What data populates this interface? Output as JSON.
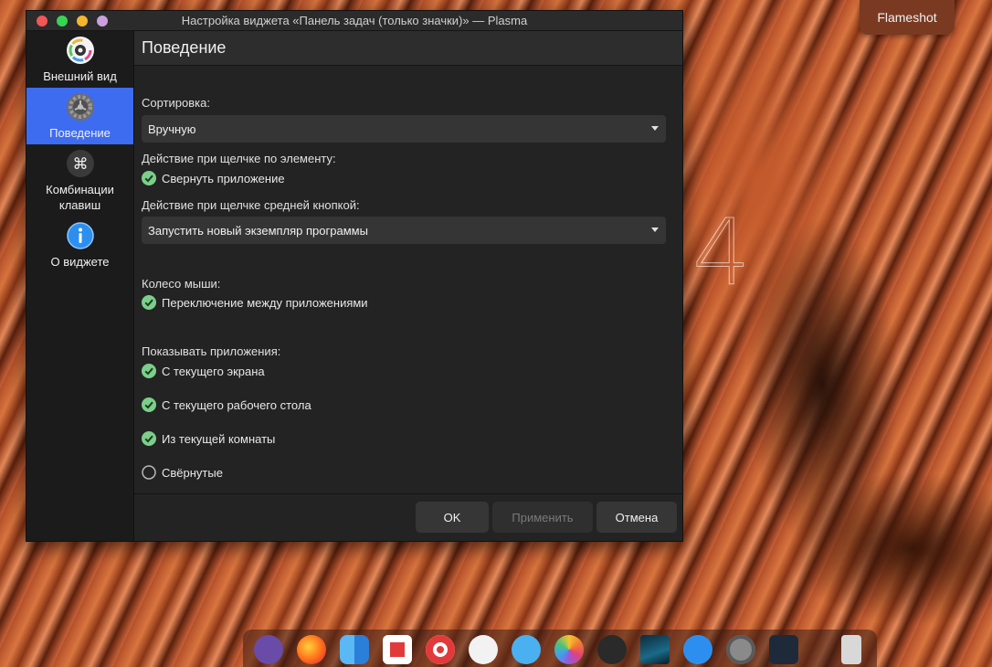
{
  "window": {
    "title": "Настройка виджета «Панель задач (только значки)» — Plasma"
  },
  "sidebar": {
    "items": [
      {
        "label": "Внешний вид",
        "icon": "appearance-icon"
      },
      {
        "label": "Поведение",
        "icon": "gear-icon",
        "active": true
      },
      {
        "label": "Комбинации\nклавиш",
        "icon": "command-key-icon"
      },
      {
        "label": "О виджете",
        "icon": "info-icon"
      }
    ]
  },
  "main": {
    "page_title": "Поведение",
    "sort": {
      "label": "Сортировка:",
      "value": "Вручную"
    },
    "click_action": {
      "label": "Действие при щелчке по элементу:",
      "option": "Свернуть приложение",
      "checked": true
    },
    "middle_click": {
      "label": "Действие при щелчке средней кнопкой:",
      "value": "Запустить новый экземпляр программы"
    },
    "wheel": {
      "label": "Колесо мыши:",
      "option": "Переключение между приложениями",
      "checked": true
    },
    "show_apps": {
      "label": "Показывать приложения:",
      "options": [
        {
          "label": "С текущего экрана",
          "checked": true
        },
        {
          "label": "С текущего рабочего стола",
          "checked": true
        },
        {
          "label": "Из текущей комнаты",
          "checked": true
        },
        {
          "label": "Свёрнутые",
          "checked": false
        }
      ]
    }
  },
  "footer": {
    "ok": "OK",
    "apply": "Применить",
    "cancel": "Отмена"
  },
  "desktop": {
    "desktop_number": "4",
    "flameshot": "Flameshot"
  },
  "dock": {
    "icons": [
      "mustache-app-icon",
      "firefox-icon",
      "finder-icon",
      "flipboard-icon",
      "record-icon",
      "proxyman-icon",
      "swift-icon",
      "photos-icon",
      "terminal-icon",
      "wallpaper-icon",
      "app-store-icon",
      "system-preferences-icon",
      "screen-sharing-icon",
      "trash-icon"
    ]
  },
  "colors": {
    "accent": "#3e6cf0",
    "check_green": "#7ccf8a"
  }
}
